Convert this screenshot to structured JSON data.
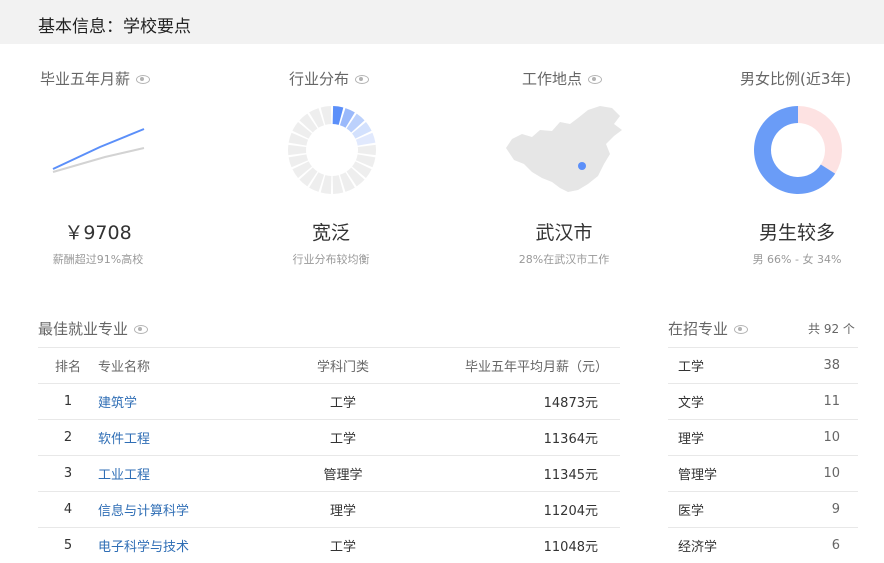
{
  "header": {
    "title": "基本信息：学校要点"
  },
  "stats": [
    {
      "title": "毕业五年月薪",
      "value": "￥9708",
      "sub": "薪酬超过91%高校",
      "chart_icon": "line-chart-icon"
    },
    {
      "title": "行业分布",
      "value": "宽泛",
      "sub": "行业分布较均衡",
      "chart_icon": "sector-ring-icon"
    },
    {
      "title": "工作地点",
      "value": "武汉市",
      "sub": "28%在武汉市工作",
      "chart_icon": "china-map-icon"
    },
    {
      "title": "男女比例(近3年)",
      "value": "男生较多",
      "sub": "男 66% - 女 34%",
      "chart_icon": "gender-donut-icon",
      "male_share": 0.66,
      "female_share": 0.34
    }
  ],
  "colors": {
    "accent": "#5b8ff9",
    "male": "#6a9cf7",
    "female": "#fde2e2",
    "link": "#2f6eb5",
    "ring_light": "#eeeeee"
  },
  "best_majors": {
    "title": "最佳就业专业",
    "columns": [
      "排名",
      "专业名称",
      "学科门类",
      "毕业五年平均月薪（元）"
    ],
    "rows": [
      {
        "rank": "1",
        "name": "建筑学",
        "category": "工学",
        "salary": "14873元"
      },
      {
        "rank": "2",
        "name": "软件工程",
        "category": "工学",
        "salary": "11364元"
      },
      {
        "rank": "3",
        "name": "工业工程",
        "category": "管理学",
        "salary": "11345元"
      },
      {
        "rank": "4",
        "name": "信息与计算科学",
        "category": "理学",
        "salary": "11204元"
      },
      {
        "rank": "5",
        "name": "电子科学与技术",
        "category": "工学",
        "salary": "11048元"
      }
    ]
  },
  "enrolling": {
    "title": "在招专业",
    "total": "共 92 个",
    "rows": [
      {
        "name": "工学",
        "count": "38"
      },
      {
        "name": "文学",
        "count": "11"
      },
      {
        "name": "理学",
        "count": "10"
      },
      {
        "name": "管理学",
        "count": "10"
      },
      {
        "name": "医学",
        "count": "9"
      },
      {
        "name": "经济学",
        "count": "6"
      }
    ]
  }
}
